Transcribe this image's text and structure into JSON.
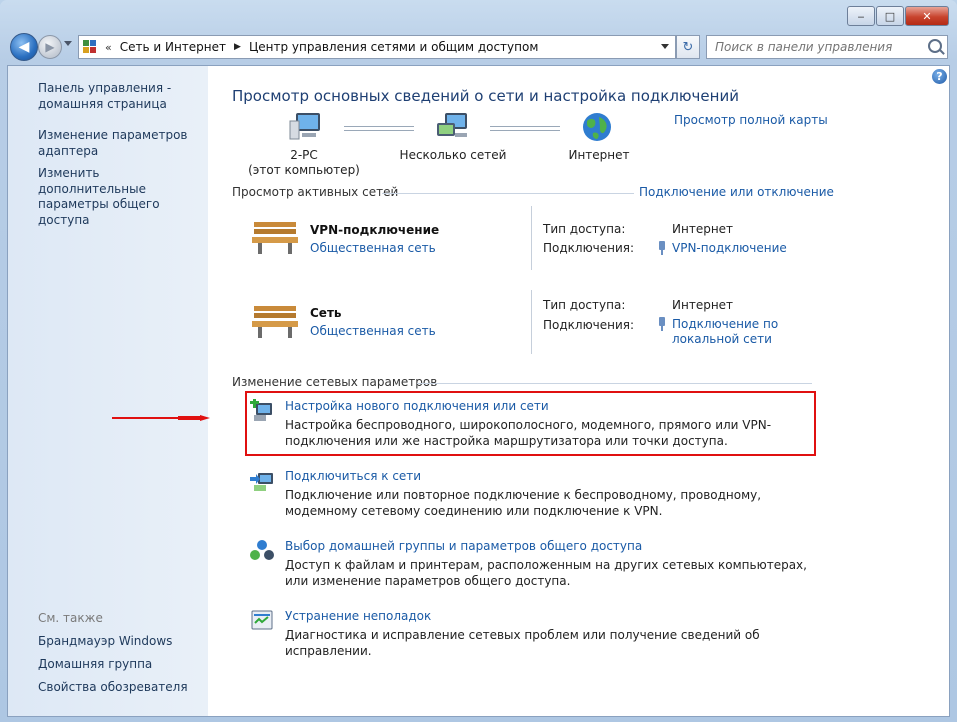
{
  "window": {
    "btn_min": "‒",
    "btn_max": "□",
    "btn_close": "✕"
  },
  "nav": {
    "back_glyph": "◀",
    "fwd_glyph": "▶",
    "breadcrumb_prefix": "«",
    "crumbs": [
      "Сеть и Интернет",
      "Центр управления сетями и общим доступом"
    ],
    "crumb_sep": "▶",
    "refresh_glyph": "↻",
    "search_placeholder": "Поиск в панели управления"
  },
  "sidebar": {
    "home": "Панель управления - домашняя страница",
    "adapter": "Изменение параметров адаптера",
    "sharing": "Изменить дополнительные параметры общего доступа",
    "see_also": "См. также",
    "see_also_links": [
      "Брандмауэр Windows",
      "Домашняя группа",
      "Свойства обозревателя"
    ],
    "help_glyph": "?"
  },
  "main": {
    "heading": "Просмотр основных сведений о сети и настройка подключений",
    "full_map": "Просмотр полной карты",
    "map_nodes": [
      {
        "name": "2-PC",
        "sub": "(этот компьютер)"
      },
      {
        "name": "Несколько сетей",
        "sub": ""
      },
      {
        "name": "Интернет",
        "sub": ""
      }
    ],
    "active_label": "Просмотр активных сетей",
    "connect_disconnect": "Подключение или отключение",
    "networks": [
      {
        "name": "VPN-подключение",
        "type": "Общественная сеть",
        "access_label": "Тип доступа:",
        "access": "Интернет",
        "conn_label": "Подключения:",
        "conn": "VPN-подключение"
      },
      {
        "name": "Сеть",
        "type": "Общественная сеть",
        "access_label": "Тип доступа:",
        "access": "Интернет",
        "conn_label": "Подключения:",
        "conn": "Подключение по локальной сети"
      }
    ],
    "change_label": "Изменение сетевых параметров",
    "tasks": [
      {
        "title": "Настройка нового подключения или сети",
        "desc": "Настройка беспроводного, широкополосного, модемного, прямого или VPN-подключения или же настройка маршрутизатора или точки доступа."
      },
      {
        "title": "Подключиться к сети",
        "desc": "Подключение или повторное подключение к беспроводному, проводному, модемному сетевому соединению или подключение к VPN."
      },
      {
        "title": "Выбор домашней группы и параметров общего доступа",
        "desc": "Доступ к файлам и принтерам, расположенным на других сетевых компьютерах, или изменение параметров общего доступа."
      },
      {
        "title": "Устранение неполадок",
        "desc": "Диагностика и исправление сетевых проблем или получение сведений об исправлении."
      }
    ]
  },
  "colors": {
    "highlight": "#e01010",
    "link": "#1a5aa6",
    "heading": "#1e3f73"
  }
}
